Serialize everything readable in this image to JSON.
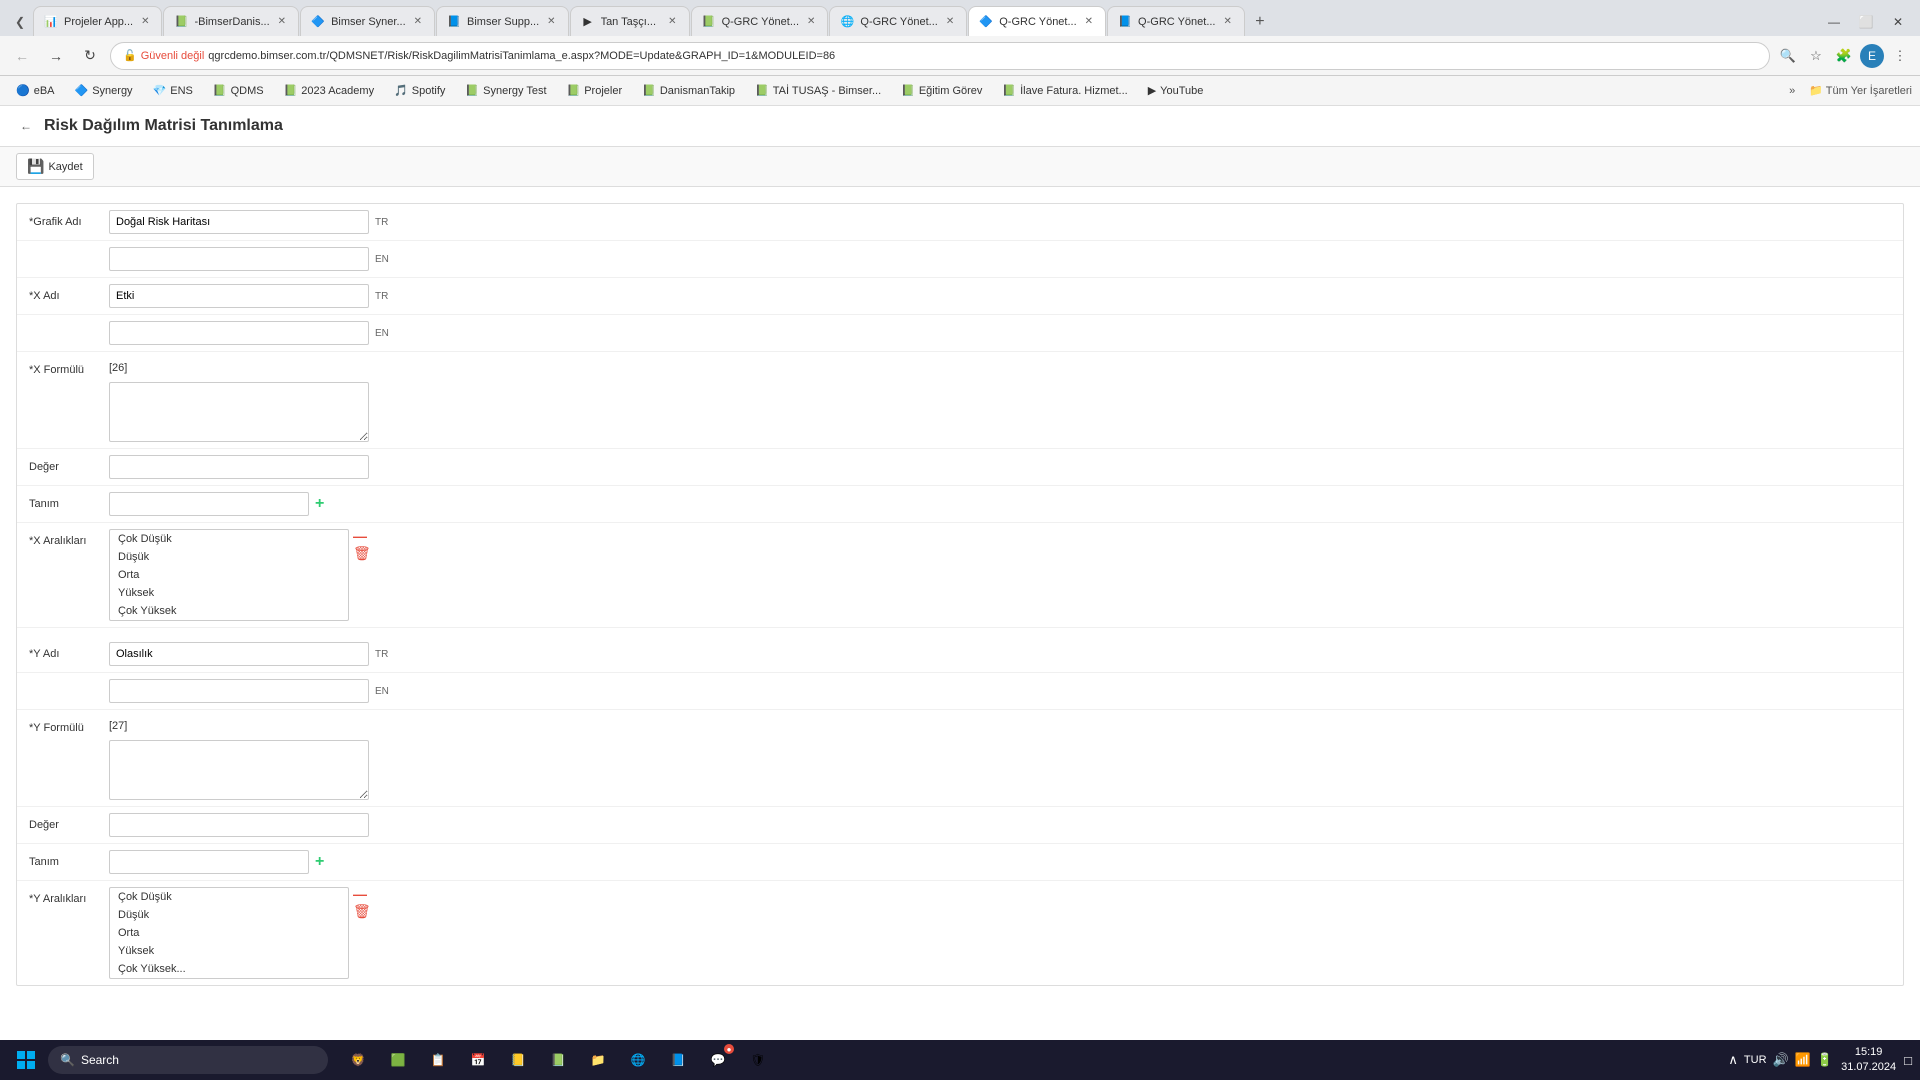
{
  "tabs": [
    {
      "id": "t1",
      "label": "Projeler App...",
      "favicon": "📊",
      "active": false,
      "closable": true
    },
    {
      "id": "t2",
      "label": "-BimserDanis...",
      "favicon": "📗",
      "active": false,
      "closable": true
    },
    {
      "id": "t3",
      "label": "Bimser Syner...",
      "favicon": "🔷",
      "active": false,
      "closable": true
    },
    {
      "id": "t4",
      "label": "Bimser Supp...",
      "favicon": "📘",
      "active": false,
      "closable": true
    },
    {
      "id": "t5",
      "label": "Tan Taşçı...",
      "favicon": "▶",
      "active": false,
      "closable": true
    },
    {
      "id": "t6",
      "label": "Q-GRC Yönet...",
      "favicon": "📗",
      "active": false,
      "closable": true
    },
    {
      "id": "t7",
      "label": "Q-GRC Yönet...",
      "favicon": "🌐",
      "active": false,
      "closable": true
    },
    {
      "id": "t8",
      "label": "Q-GRC Yönet...",
      "favicon": "🔷",
      "active": true,
      "closable": true
    },
    {
      "id": "t9",
      "label": "Q-GRC Yönet...",
      "favicon": "📘",
      "active": false,
      "closable": true
    }
  ],
  "address_bar": {
    "lock_label": "Güvenli değil",
    "url": "qgrcdemo.bimser.com.tr/QDMSNET/Risk/RiskDagilimMatrisiTanimlama_e.aspx?MODE=Update&GRAPH_ID=1&MODULEID=86"
  },
  "bookmarks": [
    {
      "label": "eBA",
      "favicon": "🔵"
    },
    {
      "label": "Synergy",
      "favicon": "🔷"
    },
    {
      "label": "ENS",
      "favicon": "💎"
    },
    {
      "label": "QDMS",
      "favicon": "📗"
    },
    {
      "label": "2023 Academy",
      "favicon": "📗"
    },
    {
      "label": "Spotify",
      "favicon": "🎵"
    },
    {
      "label": "Synergy Test",
      "favicon": "📗"
    },
    {
      "label": "Projeler",
      "favicon": "📗"
    },
    {
      "label": "DanismanTakip",
      "favicon": "📗"
    },
    {
      "label": "TAİ TUSAŞ - Bimser...",
      "favicon": "📗"
    },
    {
      "label": "Eğitim Görev",
      "favicon": "📗"
    },
    {
      "label": "İlave Fatura. Hizmet...",
      "favicon": "📗"
    },
    {
      "label": "YouTube",
      "favicon": "▶"
    }
  ],
  "page": {
    "title": "Risk Dağılım Matrisi Tanımlama",
    "toolbar": {
      "save_label": "Kaydet"
    },
    "form": {
      "grafik_adi_label": "*Grafik Adı",
      "grafik_adi_tr_value": "Doğal Risk Haritası",
      "grafik_adi_en_value": "",
      "tr_label": "TR",
      "en_label": "EN",
      "x_adi_label": "*X Adı",
      "x_adi_tr_value": "Etki",
      "x_adi_en_value": "",
      "x_formulu_label": "*X Formülü",
      "x_formulu_tag": "[26]",
      "x_formulu_value": "",
      "deger_label": "Değer",
      "deger_value": "",
      "tanim_label": "Tanım",
      "tanim_value": "",
      "x_araliklari_label": "*X Aralıkları",
      "x_araliklari_items": [
        "Çok Düşük",
        "Düşük",
        "Orta",
        "Yüksek",
        "Çok Yüksek"
      ],
      "y_adi_label": "*Y Adı",
      "y_adi_tr_value": "Olasılık",
      "y_adi_en_value": "",
      "y_formulu_label": "*Y Formülü",
      "y_formulu_tag": "[27]",
      "y_formulu_value": "",
      "y_deger_label": "Değer",
      "y_deger_value": "",
      "y_tanim_label": "Tanım",
      "y_tanim_value": "",
      "y_araliklari_label": "*Y Aralıkları",
      "y_araliklari_items": [
        "Çok Düşük",
        "Düşük",
        "Orta",
        "Yüksek",
        "Çok Yüksek..."
      ]
    }
  },
  "taskbar": {
    "search_placeholder": "Search",
    "time": "15:19",
    "date": "31.07.2024",
    "lang": "TUR"
  }
}
